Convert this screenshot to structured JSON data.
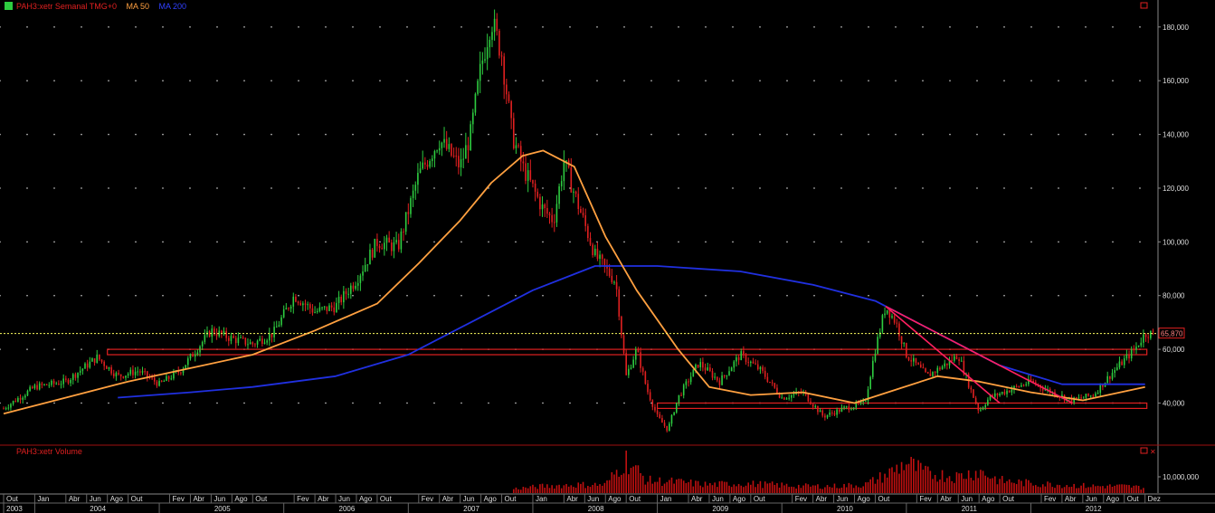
{
  "header": {
    "instrument": "PAH3:xetr Semanal TMG+0",
    "ma50_label": "MA 50",
    "ma200_label": "MA 200"
  },
  "volume_panel": {
    "title": "PAH3:xetr Volume"
  },
  "colors": {
    "background": "#000000",
    "up_candle": "#2ecc40",
    "down_candle": "#e02020",
    "ma50": "#ffa040",
    "ma200": "#2030e0",
    "support_lines": "#e02020",
    "trendlines": "#ff2060",
    "last_price_line": "#ffff60",
    "volume": "#c01010",
    "grid_dots": "#c8c8c8"
  },
  "chart_data": [
    {
      "type": "candlestick",
      "title": "PAH3:xetr Semanal TMG+0",
      "frequency": "weekly",
      "x_range": [
        "2003-10",
        "2012-12"
      ],
      "ylim": [
        25000,
        186000
      ],
      "y_ticks": [
        40000,
        60000,
        80000,
        100000,
        120000,
        140000,
        160000,
        180000
      ],
      "y_tick_labels": [
        "40,000",
        "60,000",
        "80,000",
        "100,000",
        "120,000",
        "140,000",
        "160,000",
        "180,000"
      ],
      "last_price": 65870,
      "last_price_label": "65,870",
      "grid": "dotted",
      "price_path": [
        [
          "2003-10",
          38000
        ],
        [
          "2004-01",
          46000
        ],
        [
          "2004-04",
          48000
        ],
        [
          "2004-07",
          57000
        ],
        [
          "2004-09",
          50000
        ],
        [
          "2004-11",
          52000
        ],
        [
          "2005-01",
          47000
        ],
        [
          "2005-03",
          52000
        ],
        [
          "2005-06",
          67000
        ],
        [
          "2005-08",
          64000
        ],
        [
          "2005-10",
          62000
        ],
        [
          "2005-12",
          66000
        ],
        [
          "2006-02",
          80000
        ],
        [
          "2006-04",
          74000
        ],
        [
          "2006-06",
          76000
        ],
        [
          "2006-08",
          86000
        ],
        [
          "2006-10",
          100000
        ],
        [
          "2006-12",
          98000
        ],
        [
          "2007-02",
          125000
        ],
        [
          "2007-04",
          138000
        ],
        [
          "2007-06",
          128000
        ],
        [
          "2007-07",
          140000
        ],
        [
          "2007-08",
          165000
        ],
        [
          "2007-09",
          183000
        ],
        [
          "2007-10",
          170000
        ],
        [
          "2007-11",
          140000
        ],
        [
          "2007-12",
          128000
        ],
        [
          "2008-02",
          112000
        ],
        [
          "2008-03",
          108000
        ],
        [
          "2008-04",
          130000
        ],
        [
          "2008-05",
          118000
        ],
        [
          "2008-07",
          95000
        ],
        [
          "2008-09",
          85000
        ],
        [
          "2008-10",
          50000
        ],
        [
          "2008-11",
          60000
        ],
        [
          "2008-12",
          45000
        ],
        [
          "2009-01",
          35000
        ],
        [
          "2009-02",
          30000
        ],
        [
          "2009-03",
          42000
        ],
        [
          "2009-05",
          55000
        ],
        [
          "2009-07",
          48000
        ],
        [
          "2009-09",
          58000
        ],
        [
          "2009-11",
          52000
        ],
        [
          "2010-01",
          42000
        ],
        [
          "2010-03",
          44000
        ],
        [
          "2010-05",
          35000
        ],
        [
          "2010-07",
          38000
        ],
        [
          "2010-09",
          40000
        ],
        [
          "2010-10",
          60000
        ],
        [
          "2010-11",
          76000
        ],
        [
          "2010-12",
          70000
        ],
        [
          "2011-01",
          58000
        ],
        [
          "2011-03",
          50000
        ],
        [
          "2011-05",
          55000
        ],
        [
          "2011-06",
          58000
        ],
        [
          "2011-07",
          47000
        ],
        [
          "2011-08",
          37000
        ],
        [
          "2011-09",
          42000
        ],
        [
          "2011-11",
          45000
        ],
        [
          "2012-01",
          48000
        ],
        [
          "2012-03",
          44000
        ],
        [
          "2012-05",
          41000
        ],
        [
          "2012-07",
          43000
        ],
        [
          "2012-09",
          52000
        ],
        [
          "2012-11",
          60000
        ],
        [
          "2012-12",
          65870
        ]
      ],
      "ma50": [
        [
          "2003-10",
          36000
        ],
        [
          "2004-04",
          42000
        ],
        [
          "2004-10",
          48000
        ],
        [
          "2005-04",
          53000
        ],
        [
          "2005-10",
          58000
        ],
        [
          "2006-04",
          67000
        ],
        [
          "2006-10",
          77000
        ],
        [
          "2007-02",
          92000
        ],
        [
          "2007-06",
          108000
        ],
        [
          "2007-09",
          122000
        ],
        [
          "2007-12",
          132000
        ],
        [
          "2008-02",
          134000
        ],
        [
          "2008-05",
          128000
        ],
        [
          "2008-08",
          102000
        ],
        [
          "2008-11",
          82000
        ],
        [
          "2009-03",
          60000
        ],
        [
          "2009-06",
          46000
        ],
        [
          "2009-10",
          43000
        ],
        [
          "2010-03",
          44000
        ],
        [
          "2010-08",
          40000
        ],
        [
          "2010-12",
          45000
        ],
        [
          "2011-04",
          50000
        ],
        [
          "2011-08",
          48000
        ],
        [
          "2012-01",
          44000
        ],
        [
          "2012-06",
          41000
        ],
        [
          "2012-12",
          46000
        ]
      ],
      "ma200": [
        [
          "2004-09",
          42000
        ],
        [
          "2005-04",
          44000
        ],
        [
          "2005-10",
          46000
        ],
        [
          "2006-06",
          50000
        ],
        [
          "2007-01",
          58000
        ],
        [
          "2007-07",
          70000
        ],
        [
          "2008-01",
          82000
        ],
        [
          "2008-07",
          91000
        ],
        [
          "2009-01",
          91000
        ],
        [
          "2009-09",
          89000
        ],
        [
          "2010-04",
          84000
        ],
        [
          "2010-10",
          78000
        ],
        [
          "2011-04",
          66000
        ],
        [
          "2011-10",
          54000
        ],
        [
          "2012-04",
          47000
        ],
        [
          "2012-12",
          47000
        ]
      ],
      "support_zones": [
        {
          "from": "2004-08",
          "to": "2012-12",
          "low": 58000,
          "high": 60000
        },
        {
          "from": "2009-01",
          "to": "2012-12",
          "low": 38000,
          "high": 40000
        }
      ],
      "trendlines": [
        {
          "from": [
            "2010-11",
            76000
          ],
          "to": [
            "2011-10",
            40000
          ]
        },
        {
          "from": [
            "2010-11",
            76000
          ],
          "to": [
            "2012-05",
            40000
          ]
        }
      ],
      "x_month_labels": [
        [
          "2003-10",
          "Out"
        ],
        [
          "2004-01",
          "Jan"
        ],
        [
          "2004-04",
          "Abr"
        ],
        [
          "2004-06",
          "Jun"
        ],
        [
          "2004-08",
          "Ago"
        ],
        [
          "2004-10",
          "Out"
        ],
        [
          "2005-02",
          "Fev"
        ],
        [
          "2005-04",
          "Abr"
        ],
        [
          "2005-06",
          "Jun"
        ],
        [
          "2005-08",
          "Ago"
        ],
        [
          "2005-10",
          "Out"
        ],
        [
          "2006-02",
          "Fev"
        ],
        [
          "2006-04",
          "Abr"
        ],
        [
          "2006-06",
          "Jun"
        ],
        [
          "2006-08",
          "Ago"
        ],
        [
          "2006-10",
          "Out"
        ],
        [
          "2007-02",
          "Fev"
        ],
        [
          "2007-04",
          "Abr"
        ],
        [
          "2007-06",
          "Jun"
        ],
        [
          "2007-08",
          "Ago"
        ],
        [
          "2007-10",
          "Out"
        ],
        [
          "2008-01",
          "Jan"
        ],
        [
          "2008-04",
          "Abr"
        ],
        [
          "2008-06",
          "Jun"
        ],
        [
          "2008-08",
          "Ago"
        ],
        [
          "2008-10",
          "Out"
        ],
        [
          "2009-01",
          "Jan"
        ],
        [
          "2009-04",
          "Abr"
        ],
        [
          "2009-06",
          "Jun"
        ],
        [
          "2009-08",
          "Ago"
        ],
        [
          "2009-10",
          "Out"
        ],
        [
          "2010-02",
          "Fev"
        ],
        [
          "2010-04",
          "Abr"
        ],
        [
          "2010-06",
          "Jun"
        ],
        [
          "2010-08",
          "Ago"
        ],
        [
          "2010-10",
          "Out"
        ],
        [
          "2011-02",
          "Fev"
        ],
        [
          "2011-04",
          "Abr"
        ],
        [
          "2011-06",
          "Jun"
        ],
        [
          "2011-08",
          "Ago"
        ],
        [
          "2011-10",
          "Out"
        ],
        [
          "2012-02",
          "Fev"
        ],
        [
          "2012-04",
          "Abr"
        ],
        [
          "2012-06",
          "Jun"
        ],
        [
          "2012-08",
          "Ago"
        ],
        [
          "2012-10",
          "Out"
        ],
        [
          "2012-12",
          "Dez"
        ]
      ],
      "x_year_labels": [
        "2003",
        "2004",
        "2005",
        "2006",
        "2007",
        "2008",
        "2009",
        "2010",
        "2011",
        "2012"
      ]
    },
    {
      "type": "bar",
      "title": "PAH3:xetr Volume",
      "y_tick_labels": [
        "10,000,000"
      ],
      "y_ticks": [
        10000000
      ],
      "ylim": [
        0,
        25000000
      ],
      "notes": "weekly volume bars visible from 2007-11 onward",
      "volume_path": [
        [
          "2007-11",
          3000000
        ],
        [
          "2008-02",
          5000000
        ],
        [
          "2008-05",
          6000000
        ],
        [
          "2008-08",
          6000000
        ],
        [
          "2008-10",
          24000000
        ],
        [
          "2008-12",
          9000000
        ],
        [
          "2009-03",
          8000000
        ],
        [
          "2009-06",
          6000000
        ],
        [
          "2009-09",
          7000000
        ],
        [
          "2009-12",
          6000000
        ],
        [
          "2010-03",
          5000000
        ],
        [
          "2010-06",
          5000000
        ],
        [
          "2010-09",
          6000000
        ],
        [
          "2010-11",
          13000000
        ],
        [
          "2011-01",
          22000000
        ],
        [
          "2011-03",
          14000000
        ],
        [
          "2011-06",
          12000000
        ],
        [
          "2011-08",
          16000000
        ],
        [
          "2011-10",
          9000000
        ],
        [
          "2012-01",
          7000000
        ],
        [
          "2012-04",
          6000000
        ],
        [
          "2012-07",
          5000000
        ],
        [
          "2012-10",
          5000000
        ],
        [
          "2012-12",
          4000000
        ]
      ]
    }
  ]
}
